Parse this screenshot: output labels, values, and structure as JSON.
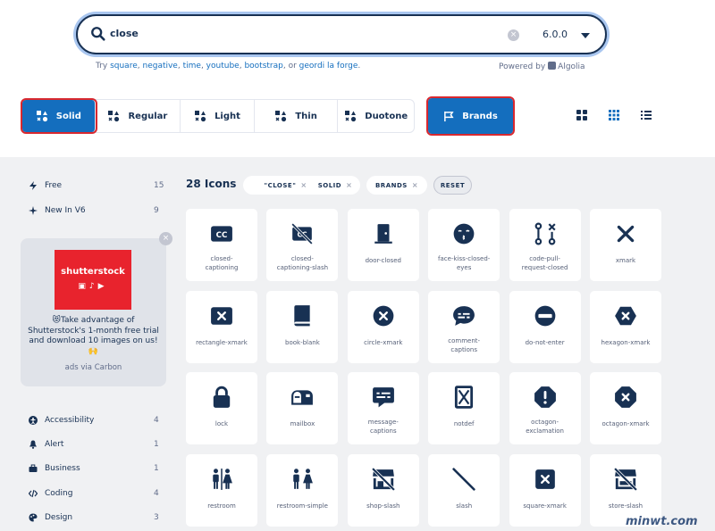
{
  "search": {
    "query": "close",
    "version": "6.0.0",
    "clear_glyph": "×"
  },
  "hint": {
    "try": "Try",
    "or": "or",
    "terms": [
      "square",
      "negative",
      "time",
      "youtube",
      "bootstrap",
      "geordi la forge"
    ],
    "powered": "Powered by",
    "provider": "Algolia"
  },
  "styles": [
    {
      "label": "Solid",
      "icon": "shapes-icon",
      "active": true
    },
    {
      "label": "Regular",
      "icon": "shapes-icon",
      "active": false
    },
    {
      "label": "Light",
      "icon": "shapes-icon",
      "active": false
    },
    {
      "label": "Thin",
      "icon": "shapes-icon",
      "active": false
    },
    {
      "label": "Duotone",
      "icon": "shapes-icon",
      "active": false
    }
  ],
  "brands": {
    "label": "Brands",
    "icon": "flag-icon"
  },
  "views": [
    "large-grid-icon",
    "small-grid-icon",
    "list-icon"
  ],
  "sidebar_top": [
    {
      "label": "Free",
      "count": "15",
      "icon": "bolt-icon"
    },
    {
      "label": "New In V6",
      "count": "9",
      "icon": "sparkle-icon"
    }
  ],
  "ad": {
    "close": "×",
    "brand": "shutterstock",
    "text": "😻Take advantage of Shutterstock's 1-month free trial and download 10 images on us! 🙌",
    "via": "ads via Carbon"
  },
  "sidebar_categories": [
    {
      "label": "Accessibility",
      "count": "4",
      "icon": "universal-access-icon"
    },
    {
      "label": "Alert",
      "count": "1",
      "icon": "bell-icon"
    },
    {
      "label": "Business",
      "count": "1",
      "icon": "briefcase-icon"
    },
    {
      "label": "Coding",
      "count": "4",
      "icon": "code-icon"
    },
    {
      "label": "Design",
      "count": "3",
      "icon": "palette-icon"
    }
  ],
  "results": {
    "count_label": "28 Icons",
    "filters": [
      {
        "label": "\"CLOSE\"",
        "x": "×"
      },
      {
        "label": "SOLID",
        "x": "×"
      },
      {
        "label": "BRANDS",
        "x": "×"
      }
    ],
    "reset": "RESET"
  },
  "icons": [
    {
      "name": "closed-captioning",
      "label": "closed-\ncaptioning"
    },
    {
      "name": "closed-captioning-slash",
      "label": "closed-\ncaptioning-slash"
    },
    {
      "name": "door-closed",
      "label": "door-closed"
    },
    {
      "name": "face-kiss-closed-eyes",
      "label": "face-kiss-closed-\neyes"
    },
    {
      "name": "code-pull-request-closed",
      "label": "code-pull-\nrequest-closed"
    },
    {
      "name": "xmark",
      "label": "xmark"
    },
    {
      "name": "rectangle-xmark",
      "label": "rectangle-xmark"
    },
    {
      "name": "book-blank",
      "label": "book-blank"
    },
    {
      "name": "circle-xmark",
      "label": "circle-xmark"
    },
    {
      "name": "comment-captions",
      "label": "comment-\ncaptions"
    },
    {
      "name": "do-not-enter",
      "label": "do-not-enter"
    },
    {
      "name": "hexagon-xmark",
      "label": "hexagon-xmark"
    },
    {
      "name": "lock",
      "label": "lock"
    },
    {
      "name": "mailbox",
      "label": "mailbox"
    },
    {
      "name": "message-captions",
      "label": "message-\ncaptions"
    },
    {
      "name": "notdef",
      "label": "notdef"
    },
    {
      "name": "octagon-exclamation",
      "label": "octagon-\nexclamation"
    },
    {
      "name": "octagon-xmark",
      "label": "octagon-xmark"
    },
    {
      "name": "restroom",
      "label": "restroom"
    },
    {
      "name": "restroom-simple",
      "label": "restroom-simple"
    },
    {
      "name": "shop-slash",
      "label": "shop-slash"
    },
    {
      "name": "slash",
      "label": "slash"
    },
    {
      "name": "square-xmark",
      "label": "square-xmark"
    },
    {
      "name": "store-slash",
      "label": "store-slash"
    }
  ],
  "watermark": "minwt.com",
  "colors": {
    "accent": "#146ebe",
    "ink": "#183153",
    "highlight": "#d8282f",
    "panel": "#f0f1f3"
  }
}
